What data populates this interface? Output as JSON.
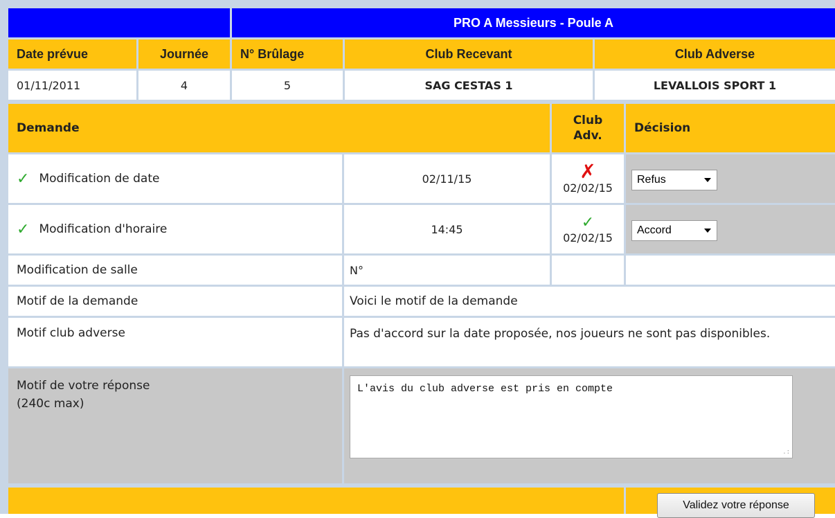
{
  "header": {
    "title": "PRO A Messieurs - Poule A"
  },
  "match_table": {
    "columns": [
      "Date prévue",
      "Journée",
      "N° Brûlage",
      "Club Recevant",
      "Club Adverse"
    ],
    "row": {
      "date": "01/11/2011",
      "journee": "4",
      "brulage": "5",
      "club_recevant": "SAG CESTAS 1",
      "club_adverse": "LEVALLOIS SPORT 1"
    }
  },
  "request_table": {
    "headers": {
      "demande": "Demande",
      "club_adv": "Club Adv.",
      "decision": "Décision"
    },
    "rows": [
      {
        "label": "Modification de date",
        "value": "02/11/15",
        "club_status_icon": "red-cross-icon",
        "club_date": "02/02/15",
        "decision": "Refus"
      },
      {
        "label": "Modification d'horaire",
        "value": "14:45",
        "club_status_icon": "green-check-icon",
        "club_date": "02/02/15",
        "decision": "Accord"
      },
      {
        "label": "Modification de salle",
        "value": "N°"
      }
    ],
    "motif_demande": {
      "label": "Motif de la demande",
      "value": "Voici le motif de la demande"
    },
    "motif_adverse": {
      "label": "Motif club adverse",
      "value": "Pas d'accord sur la date proposée, nos joueurs ne sont pas disponibles."
    },
    "motif_reponse": {
      "label_line1": "Motif de votre réponse",
      "label_line2": "(240c max)",
      "value": "L'avis du club adverse est pris en compte"
    }
  },
  "submit": {
    "label": "Validez votre réponse"
  },
  "colors": {
    "blue": "#0000ff",
    "yellow": "#ffc20e",
    "grey": "#c8c8c8",
    "check": "#2eaa2e",
    "cross": "#e01010"
  }
}
